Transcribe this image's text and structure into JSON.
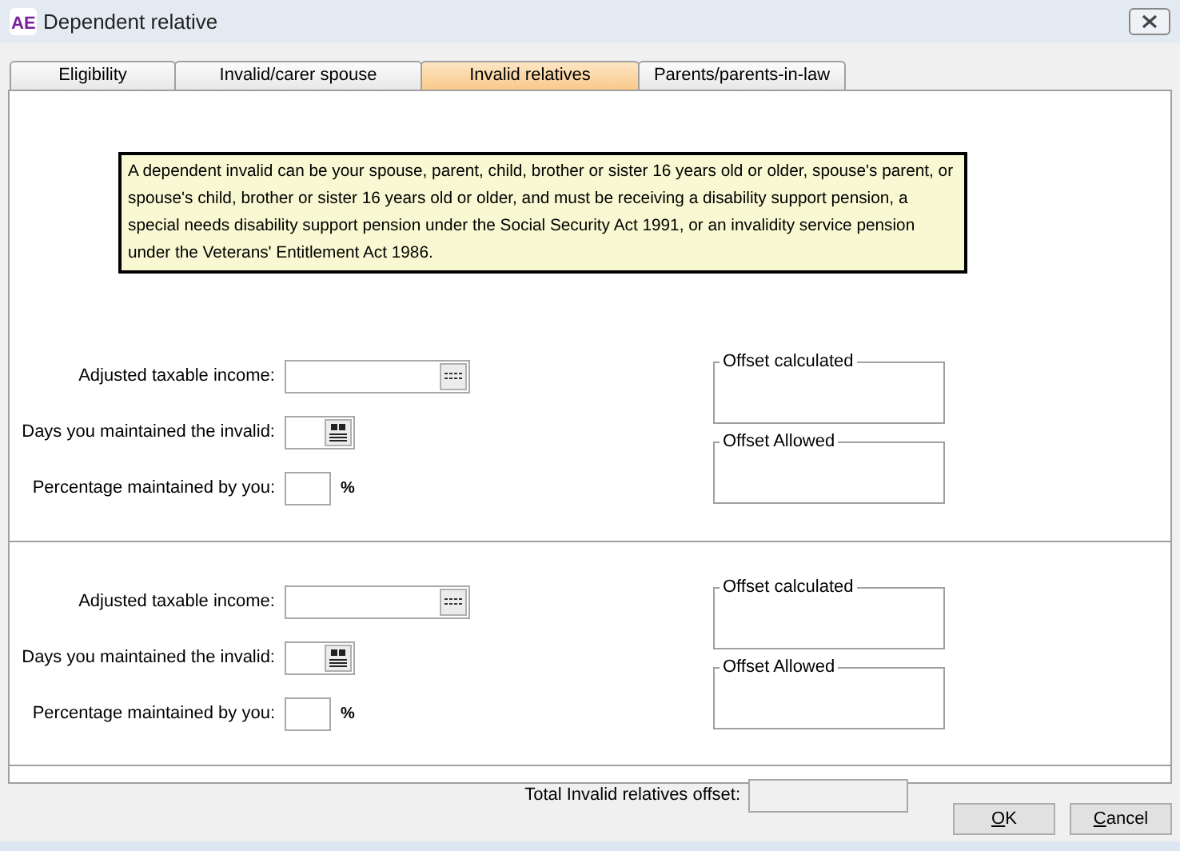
{
  "window": {
    "logo": "AE",
    "title": "Dependent relative"
  },
  "tabs": [
    {
      "label": "Eligibility",
      "selected": false
    },
    {
      "label": "Invalid/carer spouse",
      "selected": false
    },
    {
      "label": "Invalid relatives",
      "selected": true
    },
    {
      "label": "Parents/parents-in-law",
      "selected": false
    }
  ],
  "info_text": "A dependent invalid can be your spouse, parent, child, brother or sister 16 years old or older, spouse's parent, or spouse's child, brother or sister 16 years old or older, and must be receiving a disability support pension, a special needs disability support pension under the Social Security Act 1991, or an invalidity service pension under the Veterans' Entitlement Act 1986.",
  "sections": [
    {
      "fields": [
        {
          "kind": "calculator",
          "label": "Adjusted taxable income:"
        },
        {
          "kind": "calendar",
          "label": "Days you maintained the invalid:"
        },
        {
          "kind": "percent",
          "label": "Percentage maintained by you:",
          "suffix": "%"
        }
      ],
      "offsets": [
        {
          "label": "Offset calculated"
        },
        {
          "label": "Offset Allowed"
        }
      ]
    },
    {
      "fields": [
        {
          "kind": "calculator",
          "label": "Adjusted taxable income:"
        },
        {
          "kind": "calendar",
          "label": "Days you maintained the invalid:"
        },
        {
          "kind": "percent",
          "label": "Percentage maintained by you:",
          "suffix": "%"
        }
      ],
      "offsets": [
        {
          "label": "Offset calculated"
        },
        {
          "label": "Offset Allowed"
        }
      ]
    }
  ],
  "total": {
    "label": "Total Invalid relatives offset:"
  },
  "buttons": [
    {
      "label": "OK"
    },
    {
      "label": "Cancel"
    }
  ]
}
